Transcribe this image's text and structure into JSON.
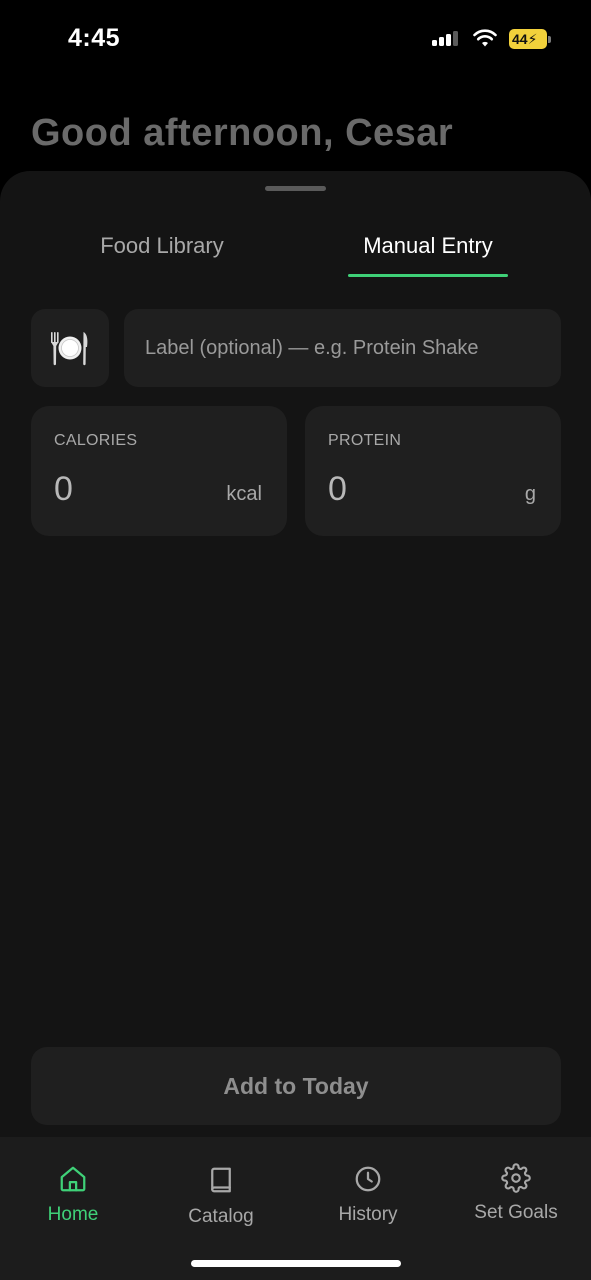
{
  "status_bar": {
    "time": "4:45",
    "battery": "44",
    "battery_color": "#f2d13b"
  },
  "header": {
    "greeting": "Good afternoon, Cesar"
  },
  "tabs": [
    {
      "label": "Food Library",
      "active": false
    },
    {
      "label": "Manual Entry",
      "active": true
    }
  ],
  "manual_entry": {
    "icon": "plate-utensils-icon",
    "label_placeholder": "Label (optional) — e.g. Protein Shake",
    "label_value": "",
    "calories": {
      "label": "CALORIES",
      "value": "0",
      "unit": "kcal"
    },
    "protein": {
      "label": "PROTEIN",
      "value": "0",
      "unit": "g"
    },
    "submit_label": "Add to Today"
  },
  "bottom_nav": [
    {
      "label": "Home",
      "icon": "home-icon",
      "active": true
    },
    {
      "label": "Catalog",
      "icon": "book-icon",
      "active": false
    },
    {
      "label": "History",
      "icon": "clock-icon",
      "active": false
    },
    {
      "label": "Set Goals",
      "icon": "gear-icon",
      "active": false
    }
  ],
  "colors": {
    "accent": "#3fd178",
    "background": "#000000",
    "sheet": "#141414",
    "card": "#1f1f1f"
  }
}
